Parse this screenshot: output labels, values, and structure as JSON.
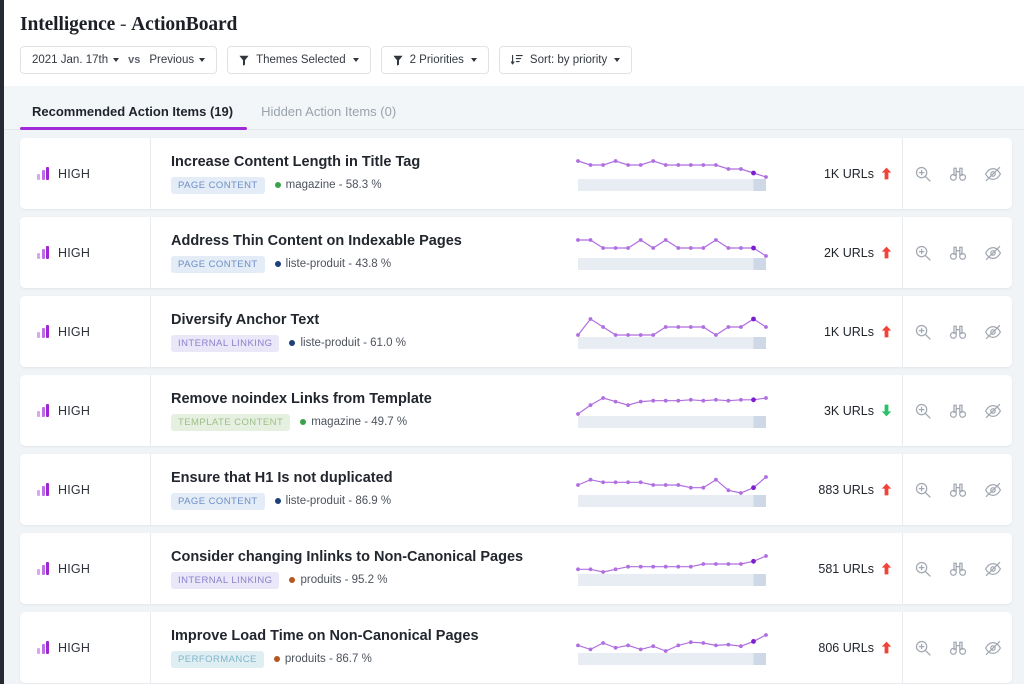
{
  "header": {
    "title_main": "Intelligence",
    "title_sep": " - ",
    "title_sub": "ActionBoard"
  },
  "toolbar": {
    "date_label": "2021 Jan. 17th",
    "vs_label": "vs",
    "compare_label": "Previous",
    "themes_label": "Themes Selected",
    "priorities_label": "2 Priorities",
    "sort_label": "Sort: by priority"
  },
  "tabs": [
    {
      "label": "Recommended Action Items (19)",
      "active": true
    },
    {
      "label": "Hidden Action Items (0)",
      "active": false
    }
  ],
  "colors": {
    "accent_purple": "#a12ad8",
    "up_arrow": "#f0433a",
    "down_arrow": "#2cc06b",
    "spark_line": "#b06fe0",
    "spark_fill": "#e8edf4",
    "spark_highlight": "#cfd8e6",
    "spark_last_point": "#7d1fd0"
  },
  "chip_styles": {
    "PAGE CONTENT": {
      "bg": "#e3ecf7",
      "fg": "#6f8fc4"
    },
    "INTERNAL LINKING": {
      "bg": "#e9e7f8",
      "fg": "#8b82cd"
    },
    "TEMPLATE CONTENT": {
      "bg": "#e6f0e1",
      "fg": "#9dbf87"
    },
    "PERFORMANCE": {
      "bg": "#dfeef3",
      "fg": "#7fb6c9"
    }
  },
  "segment_colors": {
    "magazine": "#3aa34a",
    "liste-produit": "#1d3f7a",
    "produits": "#b5561e"
  },
  "actions": {
    "explore_icon": "magnifier-plus-icon",
    "investigate_icon": "binoculars-icon",
    "hide_icon": "eye-slash-icon"
  },
  "rows": [
    {
      "priority": "HIGH",
      "title": "Increase Content Length in Title Tag",
      "chip": "PAGE CONTENT",
      "segment": "magazine",
      "segment_value": "58.3 %",
      "segment_text": "magazine - 58.3 %",
      "urls": "1K URLs",
      "trend": "up",
      "spark": [
        52,
        51,
        51,
        52,
        51,
        51,
        52,
        51,
        51,
        51,
        51,
        51,
        50,
        50,
        49,
        48
      ]
    },
    {
      "priority": "HIGH",
      "title": "Address Thin Content on Indexable Pages",
      "chip": "PAGE CONTENT",
      "segment": "liste-produit",
      "segment_value": "43.8 %",
      "segment_text": "liste-produit - 43.8 %",
      "urls": "2K URLs",
      "trend": "up",
      "spark": [
        52,
        52,
        51,
        51,
        51,
        52,
        51,
        52,
        51,
        51,
        51,
        52,
        51,
        51,
        51,
        50
      ]
    },
    {
      "priority": "HIGH",
      "title": "Diversify Anchor Text",
      "chip": "INTERNAL LINKING",
      "segment": "liste-produit",
      "segment_value": "61.0 %",
      "segment_text": "liste-produit - 61.0 %",
      "urls": "1K URLs",
      "trend": "up",
      "spark": [
        50,
        52,
        51,
        50,
        50,
        50,
        50,
        51,
        51,
        51,
        51,
        50,
        51,
        51,
        52,
        51
      ]
    },
    {
      "priority": "HIGH",
      "title": "Remove noindex Links from Template",
      "chip": "TEMPLATE CONTENT",
      "segment": "magazine",
      "segment_value": "49.7 %",
      "segment_text": "magazine - 49.7 %",
      "urls": "3K URLs",
      "trend": "down",
      "spark": [
        36,
        46,
        54,
        50,
        46,
        50,
        51,
        51,
        51,
        52,
        51,
        52,
        51,
        52,
        52,
        54
      ]
    },
    {
      "priority": "HIGH",
      "title": "Ensure that H1 Is not duplicated",
      "chip": "PAGE CONTENT",
      "segment": "liste-produit",
      "segment_value": "86.9 %",
      "segment_text": "liste-produit - 86.9 %",
      "urls": "883 URLs",
      "trend": "up",
      "spark": [
        51,
        53,
        52,
        52,
        52,
        52,
        51,
        51,
        51,
        50,
        50,
        53,
        49,
        48,
        50,
        54
      ]
    },
    {
      "priority": "HIGH",
      "title": "Consider changing Inlinks to Non-Canonical Pages",
      "chip": "INTERNAL LINKING",
      "segment": "produits",
      "segment_value": "95.2 %",
      "segment_text": "produits - 95.2 %",
      "urls": "581 URLs",
      "trend": "up",
      "spark": [
        50,
        50,
        49,
        50,
        51,
        51,
        51,
        51,
        51,
        51,
        52,
        52,
        52,
        52,
        53,
        55
      ]
    },
    {
      "priority": "HIGH",
      "title": "Improve Load Time on Non-Canonical Pages",
      "chip": "PERFORMANCE",
      "segment": "produits",
      "segment_value": "86.7 %",
      "segment_text": "produits - 86.7 %",
      "urls": "806 URLs",
      "trend": "up",
      "spark": [
        49,
        44,
        52,
        46,
        49,
        44,
        48,
        42,
        49,
        53,
        52,
        49,
        50,
        48,
        54,
        62
      ]
    }
  ]
}
